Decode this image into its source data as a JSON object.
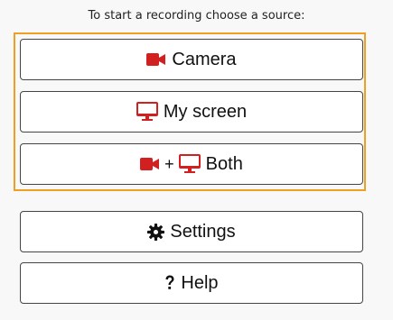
{
  "prompt": "To start a recording choose a source:",
  "accent_color": "#f0a020",
  "icon_color": "#d22020",
  "sources": {
    "camera": {
      "label": "Camera",
      "icon": "video-camera-icon"
    },
    "screen": {
      "label": "My screen",
      "icon": "monitor-icon"
    },
    "both": {
      "plus": "+",
      "label": "Both",
      "icons": [
        "video-camera-icon",
        "monitor-icon"
      ]
    }
  },
  "settings": {
    "label": "Settings",
    "icon": "gear-icon"
  },
  "help": {
    "label": "Help",
    "icon": "question-icon"
  }
}
